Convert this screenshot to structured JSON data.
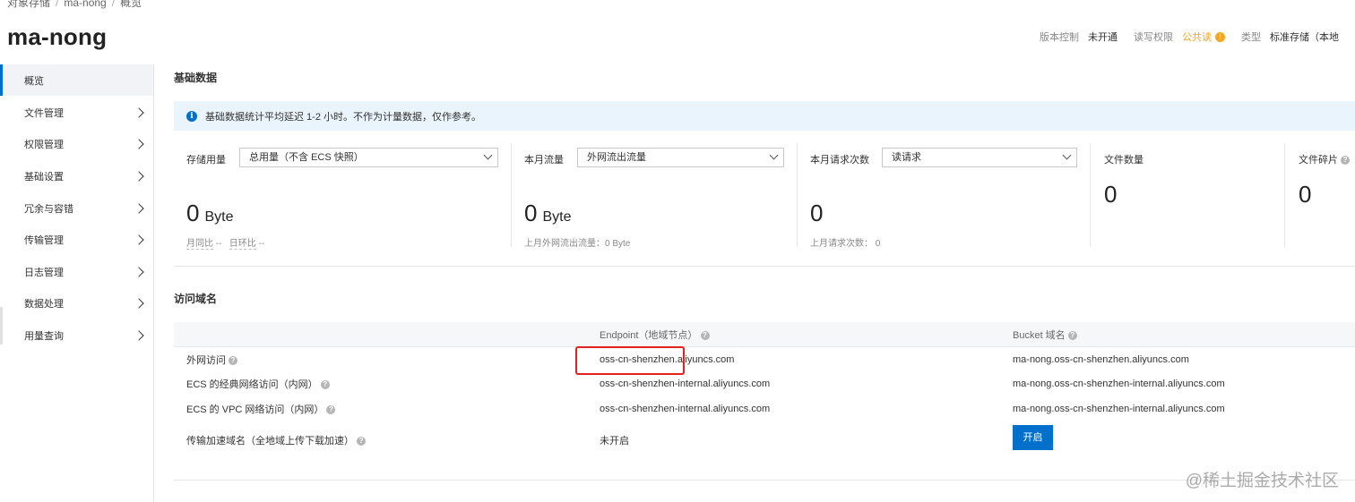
{
  "breadcrumb": [
    "对象存储",
    "ma-nong",
    "概览"
  ],
  "page_title": "ma-nong",
  "header_meta": {
    "version_label": "版本控制",
    "version_value": "未开通",
    "acl_label": "读写权限",
    "acl_value": "公共读",
    "type_label": "类型",
    "type_value": "标准存储（本地"
  },
  "sidebar": {
    "items": [
      {
        "label": "概览"
      },
      {
        "label": "文件管理"
      },
      {
        "label": "权限管理"
      },
      {
        "label": "基础设置"
      },
      {
        "label": "冗余与容错"
      },
      {
        "label": "传输管理"
      },
      {
        "label": "日志管理"
      },
      {
        "label": "数据处理"
      },
      {
        "label": "用量查询"
      }
    ]
  },
  "basic_data": {
    "title": "基础数据",
    "notice": "基础数据统计平均延迟 1-2 小时。不作为计量数据，仅作参考。",
    "storage": {
      "label": "存储用量",
      "select": "总用量（不含 ECS 快照）",
      "value": "0",
      "unit": "Byte",
      "mom_label": "月同比",
      "mom_value": "--",
      "qoq_label": "日环比",
      "qoq_value": "--"
    },
    "traffic": {
      "label": "本月流量",
      "select": "外网流出流量",
      "value": "0",
      "unit": "Byte",
      "sub": "上月外网流出流量：0 Byte"
    },
    "requests": {
      "label": "本月请求次数",
      "select": "读请求",
      "value": "0",
      "sub": "上月请求次数：  0"
    },
    "files": {
      "label": "文件数量",
      "value": "0"
    },
    "fragments": {
      "label": "文件碎片",
      "value": "0"
    }
  },
  "access_domain": {
    "title": "访问域名",
    "headers": {
      "endpoint": "Endpoint（地域节点）",
      "bucket": "Bucket 域名"
    },
    "rows": [
      {
        "name": "外网访问",
        "endpoint": "oss-cn-shenzhen.aliyuncs.com",
        "bucket": "ma-nong.oss-cn-shenzhen.aliyuncs.com"
      },
      {
        "name": "ECS 的经典网络访问（内网）",
        "endpoint": "oss-cn-shenzhen-internal.aliyuncs.com",
        "bucket": "ma-nong.oss-cn-shenzhen-internal.aliyuncs.com"
      },
      {
        "name": "ECS 的 VPC 网络访问（内网）",
        "endpoint": "oss-cn-shenzhen-internal.aliyuncs.com",
        "bucket": "ma-nong.oss-cn-shenzhen-internal.aliyuncs.com"
      }
    ],
    "accel": {
      "name": "传输加速域名（全地域上传下载加速）",
      "status": "未开启",
      "button": "开启"
    }
  },
  "watermark": "@稀土掘金技术社区",
  "colors": {
    "accent": "#0070cc",
    "warn": "#f5a623",
    "highlight": "#e3211f"
  }
}
